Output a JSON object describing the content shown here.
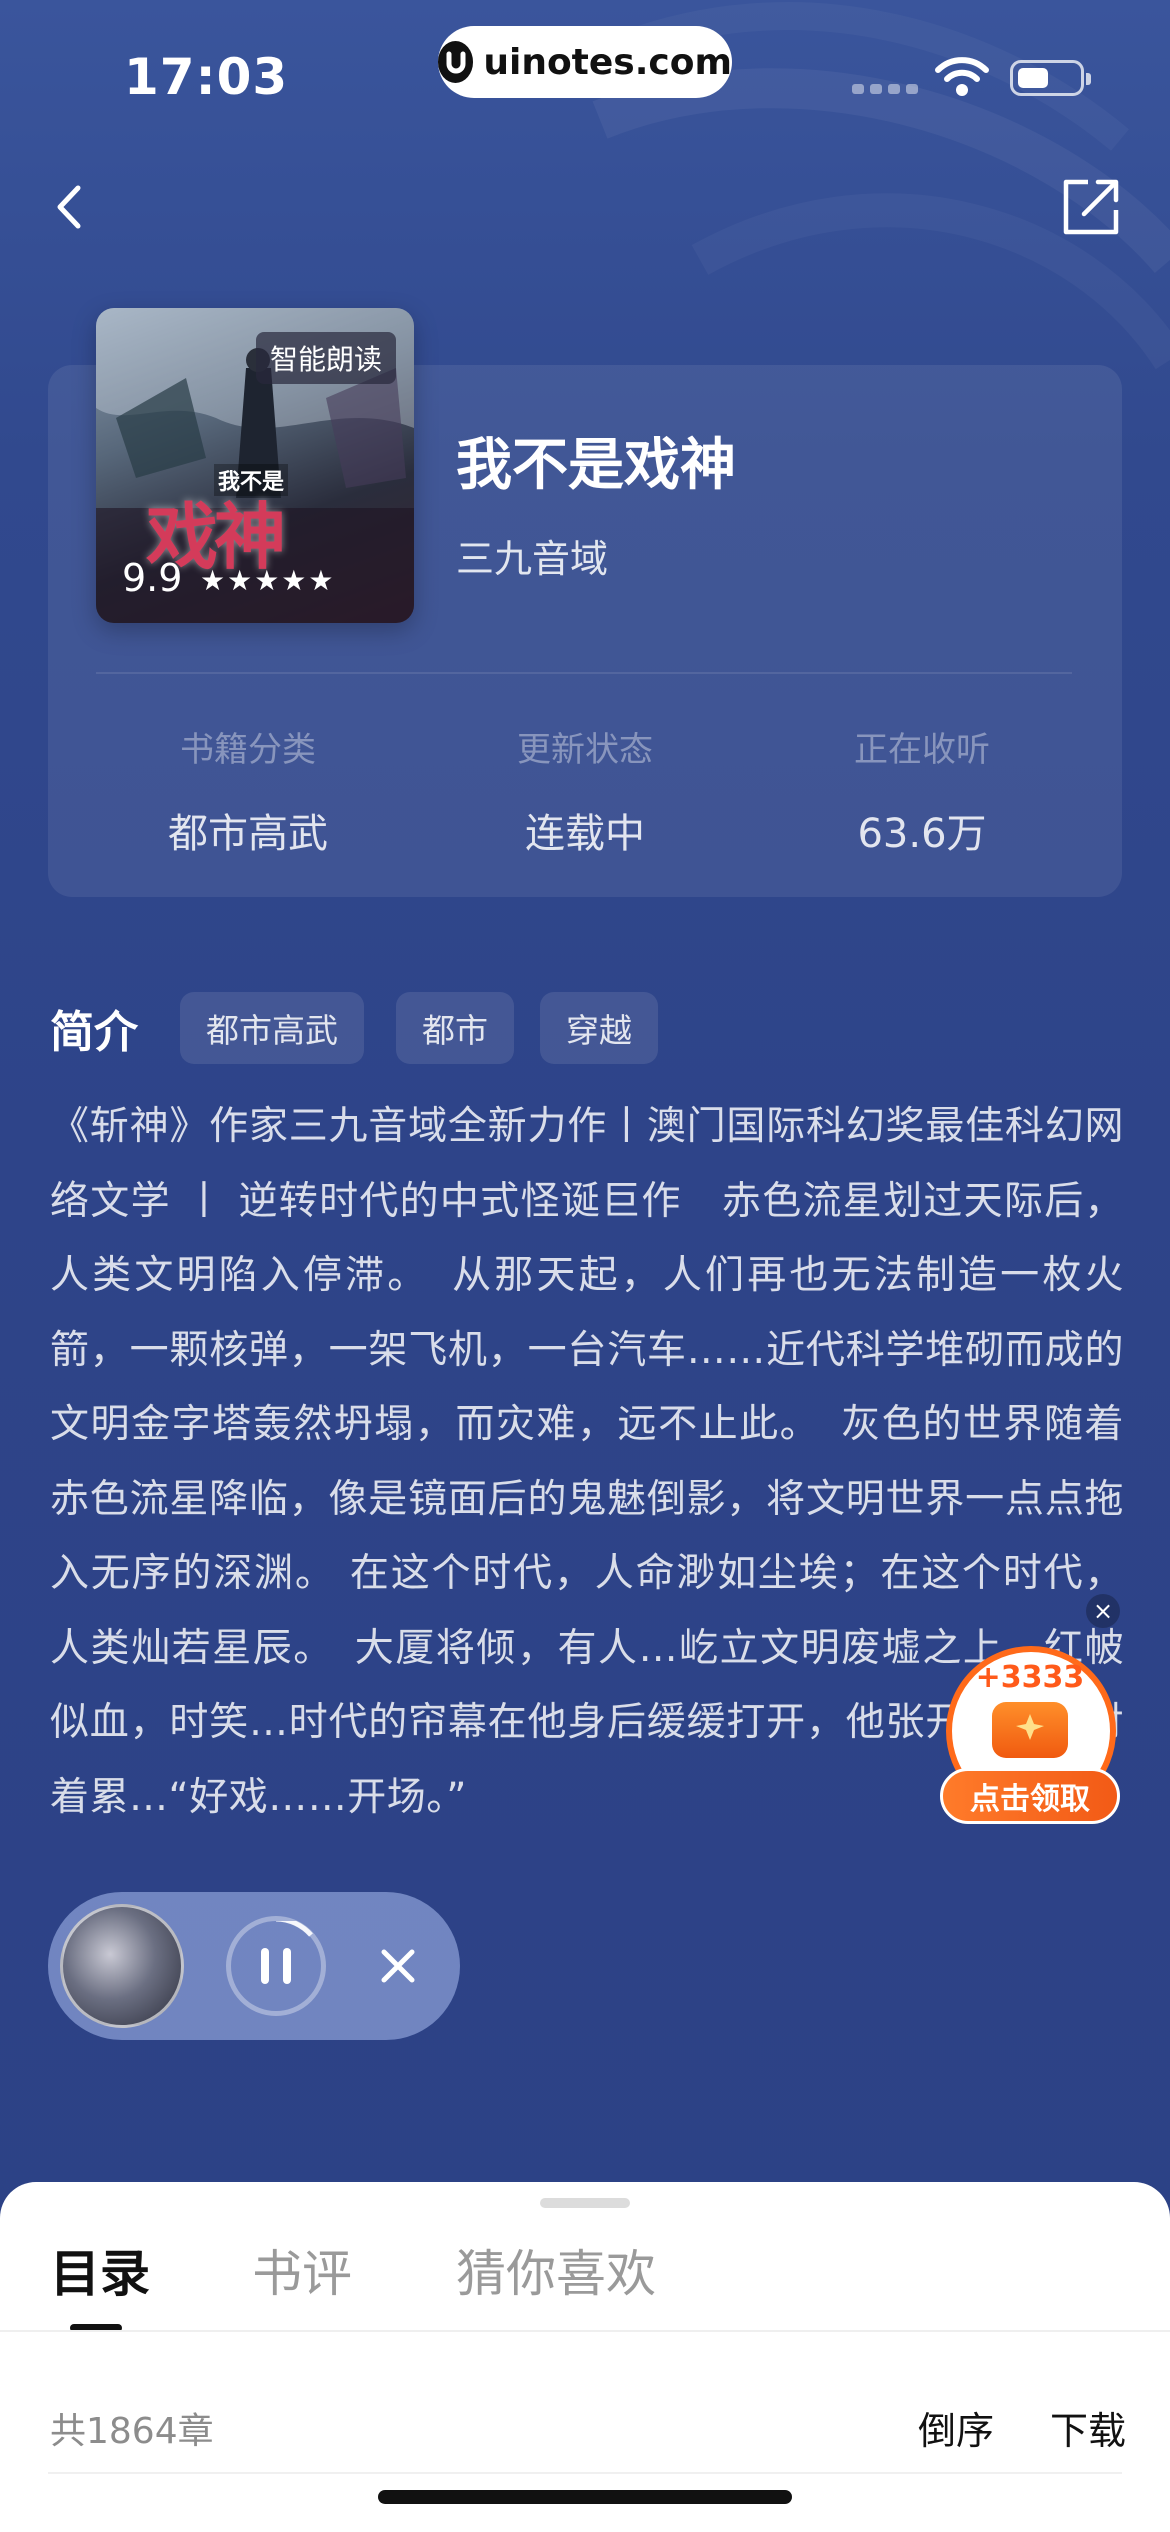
{
  "status_bar": {
    "time": "17:03",
    "url": "uinotes.com",
    "icons": [
      "signal-icon",
      "wifi-icon",
      "battery-icon"
    ]
  },
  "nav": {
    "back_icon": "chevron-left-icon",
    "share_icon": "share-icon"
  },
  "book": {
    "cover_badge": "智能朗读",
    "cover_title_small": "我不是",
    "cover_title_big": "戏神",
    "rating": "9.9",
    "stars": "★★★★★",
    "title": "我不是戏神",
    "author": "三九音域",
    "stats": [
      {
        "label": "书籍分类",
        "value": "都市高武"
      },
      {
        "label": "更新状态",
        "value": "连载中"
      },
      {
        "label": "正在收听",
        "value": "63.6万"
      }
    ]
  },
  "intro": {
    "heading": "简介",
    "tags": [
      "都市高武",
      "都市",
      "穿越"
    ],
    "text": "《斩神》作家三九音域全新力作丨澳门国际科幻奖最佳科幻网络文学 丨 逆转时代的中式怪诞巨作　赤色流星划过天际后，人类文明陷入停滞。　从那天起，人们再也无法制造一枚火箭，一颗核弹，一架飞机，一台汽车……近代科学堆砌而成的文明金字塔轰然坍塌，而灾难，远不止此。　灰色的世界随着赤色流星降临，像是镜面后的鬼魅倒影，将文明世界一点点拖入无序的深渊。 在这个时代，人命渺如尘埃；在这个时代，人类灿若星辰。　大厦将倾，有人…屹立文明废墟之上，红帔似血，时笑…时代的帘幕在他身后缓缓打开，他张开双臂，对着累…“好戏……开场。”"
  },
  "reward": {
    "amount": "+3333",
    "button": "点击领取",
    "close": "×"
  },
  "mini_player": {
    "pause_icon": "pause-icon",
    "close_icon": "close-icon"
  },
  "sheet": {
    "tabs": [
      {
        "label": "目录",
        "active": true
      },
      {
        "label": "书评",
        "active": false
      },
      {
        "label": "猜你喜欢",
        "active": false
      }
    ],
    "chapter_count": "共1864章",
    "actions": [
      "倒序",
      "下载"
    ]
  }
}
